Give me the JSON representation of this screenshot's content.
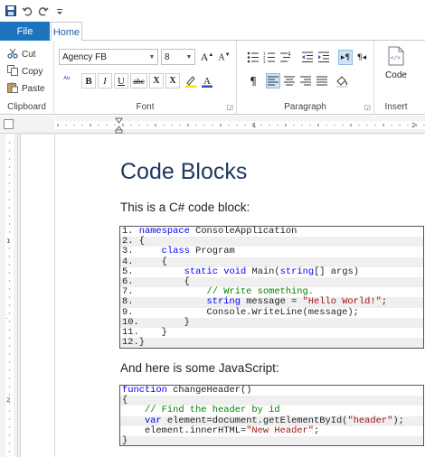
{
  "colors": {
    "file_tab": "#1e73be",
    "heading": "#1f3864",
    "keyword": "#0000ff",
    "string": "#a31515",
    "comment": "#008000"
  },
  "quick_access": {
    "icons": [
      "save-icon",
      "undo-icon",
      "redo-icon",
      "customize-icon"
    ]
  },
  "tabs": {
    "file": "File",
    "home": "Home"
  },
  "ribbon": {
    "clipboard": {
      "cut": "Cut",
      "copy": "Copy",
      "paste": "Paste",
      "label": "Clipboard"
    },
    "font": {
      "family": "Agency FB",
      "size": "8",
      "label": "Font",
      "bold": "B",
      "italic": "I",
      "underline": "U",
      "strike": "abc",
      "subscript": "X",
      "superscript": "X"
    },
    "paragraph": {
      "label": "Paragraph"
    },
    "insert": {
      "code": "Code",
      "label": "Insert"
    }
  },
  "document": {
    "heading": "Code Blocks",
    "para1": "This is a C# code block:",
    "para2": "And here is some JavaScript:",
    "csharp_lines": [
      "1. namespace ConsoleApplication",
      "2. {",
      "3.     class Program",
      "4.     {",
      "5.         static void Main(string[] args)",
      "6.         {",
      "7.             // Write something.",
      "8.             string message = \"Hello World!\";",
      "9.             Console.WriteLine(message);",
      "10.        }",
      "11.    }",
      "12.}"
    ],
    "js_lines": [
      "function changeHeader()",
      "{",
      "    // Find the header by id",
      "    var element=document.getElementById(\"header\");",
      "    element.innerHTML=\"New Header\";",
      "}"
    ]
  }
}
